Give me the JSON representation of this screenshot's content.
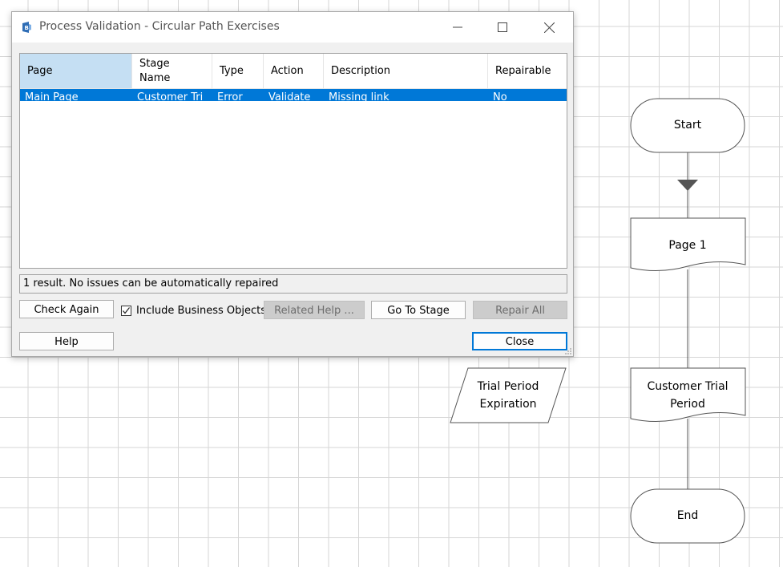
{
  "dialog": {
    "title": "Process Validation - Circular Path Exercises",
    "columns": [
      "Page",
      "Stage\nName",
      "Type",
      "Action",
      "Description",
      "Repairable"
    ],
    "rows": [
      [
        "Main Page",
        "Customer Tri",
        "Error",
        "Validate",
        "Missing link",
        "No"
      ]
    ],
    "status": "1 result. No issues can be automatically repaired",
    "buttons": {
      "check_again": "Check Again",
      "include_bo": "Include Business Objects",
      "related_help": "Related Help ...",
      "go_to_stage": "Go To Stage",
      "repair_all": "Repair All",
      "help": "Help",
      "close": "Close"
    },
    "include_bo_checked": true
  },
  "flowchart": {
    "start": "Start",
    "page1": "Page 1",
    "trial_period_expiration": "Trial Period\nExpiration",
    "customer_trial_period": "Customer Trial\nPeriod",
    "end": "End"
  },
  "colors": {
    "selection": "#0078d7",
    "header_selected": "#c5dff3",
    "grid_line": "#d6d6d6"
  }
}
